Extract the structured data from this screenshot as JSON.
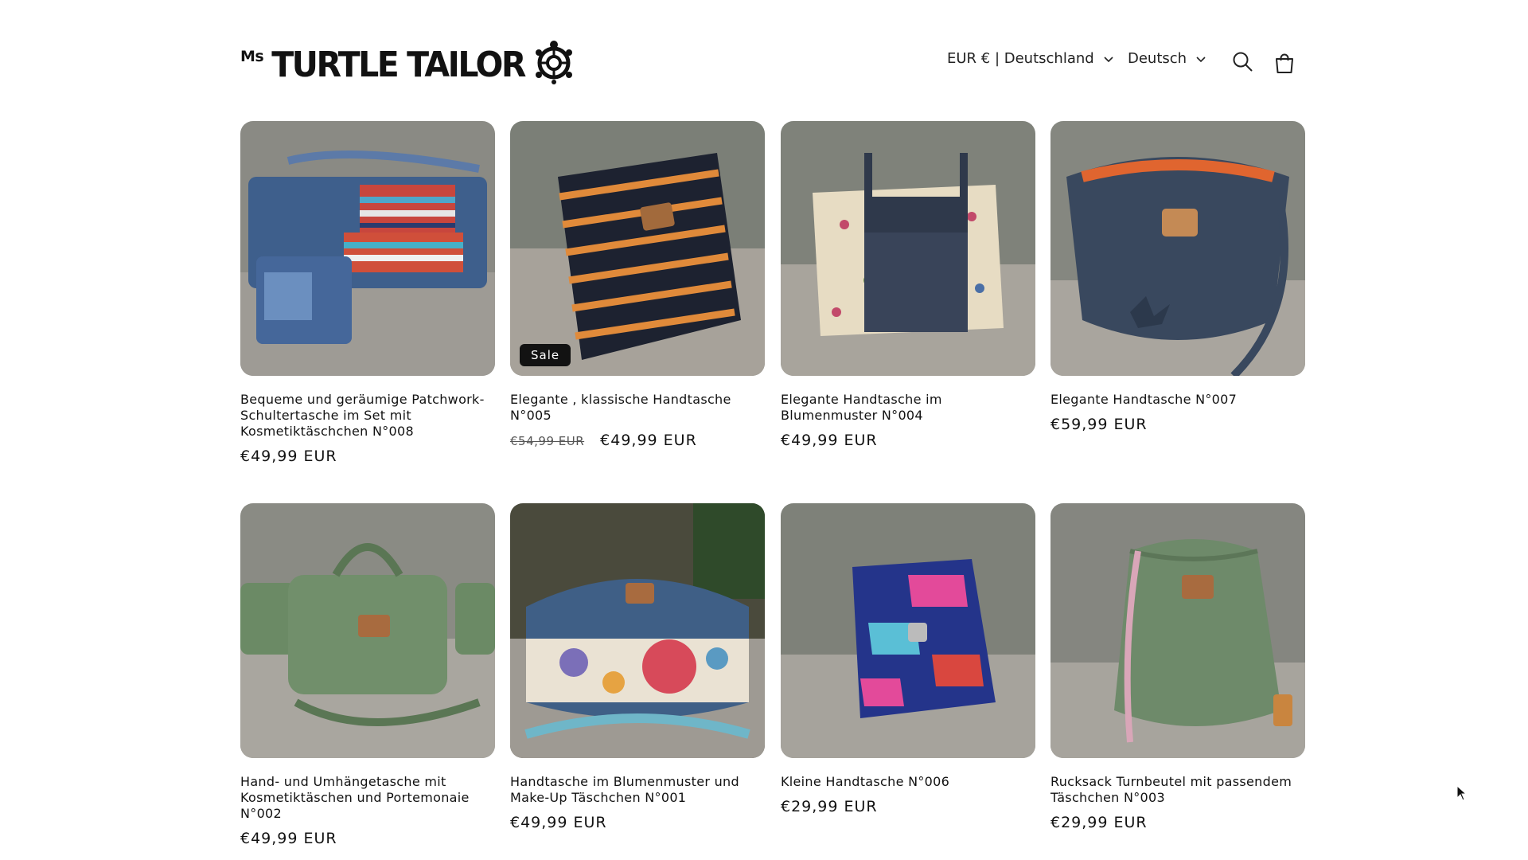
{
  "header": {
    "logo_ms": "Ms",
    "logo_text": "TURTLE TAILOR",
    "country_selector": "EUR € | Deutschland",
    "language_selector": "Deutsch"
  },
  "products": [
    {
      "title": "Bequeme und geräumige Patchwork-Schultertasche im Set mit Kosmetiktäschchen N°008",
      "price": "€49,99 EUR"
    },
    {
      "title": "Elegante , klassische Handtasche N°005",
      "price_old": "€54,99 EUR",
      "price": "€49,99 EUR",
      "badge": "Sale"
    },
    {
      "title": "Elegante Handtasche im Blumenmuster N°004",
      "price": "€49,99 EUR"
    },
    {
      "title": "Elegante Handtasche N°007",
      "price": "€59,99 EUR"
    },
    {
      "title": "Hand- und Umhängetasche mit Kosmetiktäschen und Portemonaie N°002",
      "price": "€49,99 EUR"
    },
    {
      "title": "Handtasche im Blumenmuster und Make-Up Täschchen N°001",
      "price": "€49,99 EUR"
    },
    {
      "title": "Kleine Handtasche N°006",
      "price": "€29,99 EUR"
    },
    {
      "title": "Rucksack Turnbeutel mit passendem Täschchen N°003",
      "price": "€29,99 EUR"
    }
  ],
  "icons": [
    "turtle-icon",
    "chevron-down-icon",
    "search-icon",
    "cart-icon",
    "cursor-icon"
  ]
}
